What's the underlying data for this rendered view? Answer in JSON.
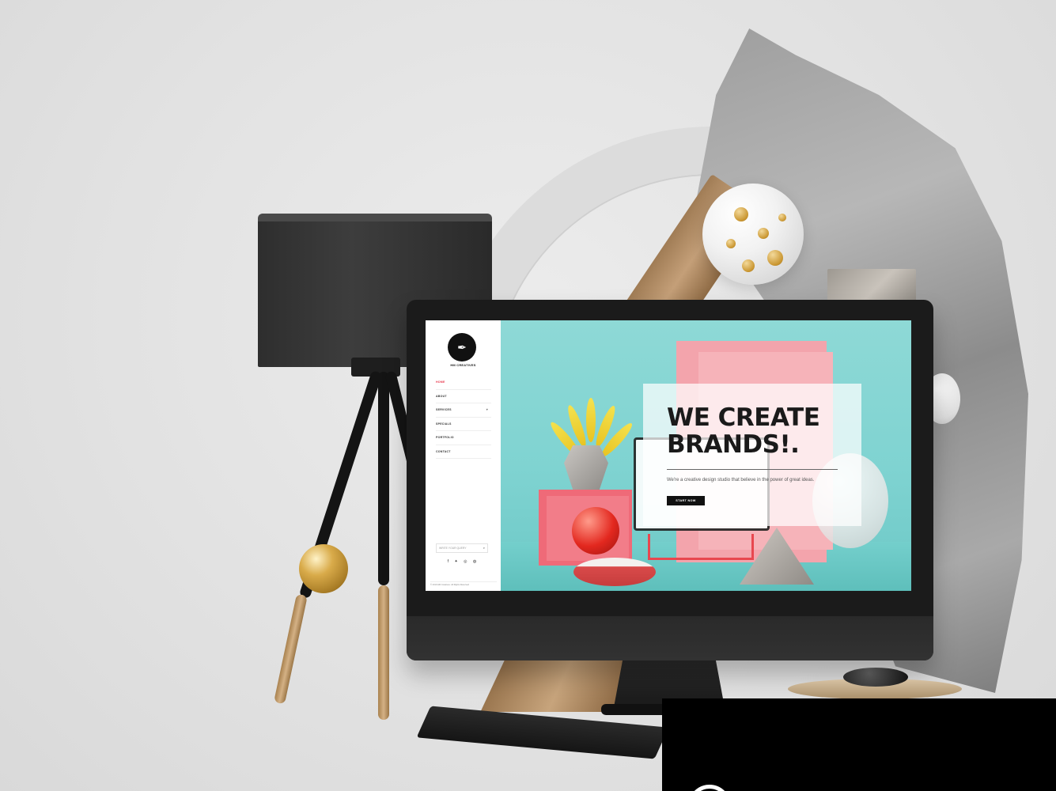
{
  "website": {
    "logo_text": "HM CREATIVES",
    "nav": [
      {
        "label": "HOME",
        "active": true
      },
      {
        "label": "ABOUT",
        "active": false
      },
      {
        "label": "SERVICES",
        "active": false,
        "has_submenu": true
      },
      {
        "label": "SPECIALS",
        "active": false
      },
      {
        "label": "PORTFOLIO",
        "active": false
      },
      {
        "label": "CONTACT",
        "active": false
      }
    ],
    "search_placeholder": "WRITE YOUR QUERY",
    "social_icons": [
      "facebook-icon",
      "twitter-icon",
      "instagram-icon",
      "pinterest-icon"
    ],
    "social_glyphs": "f ✦ ◎ ◍",
    "copyright": "© 2019 HM Creatives. All Rights Reserved",
    "hero": {
      "title": "WE CREATE BRANDS!.",
      "subtitle": "We're a creative design studio that believe in the power of great ideas.",
      "cta_label": "START NOW"
    },
    "accent_color": "#e83a4f"
  }
}
